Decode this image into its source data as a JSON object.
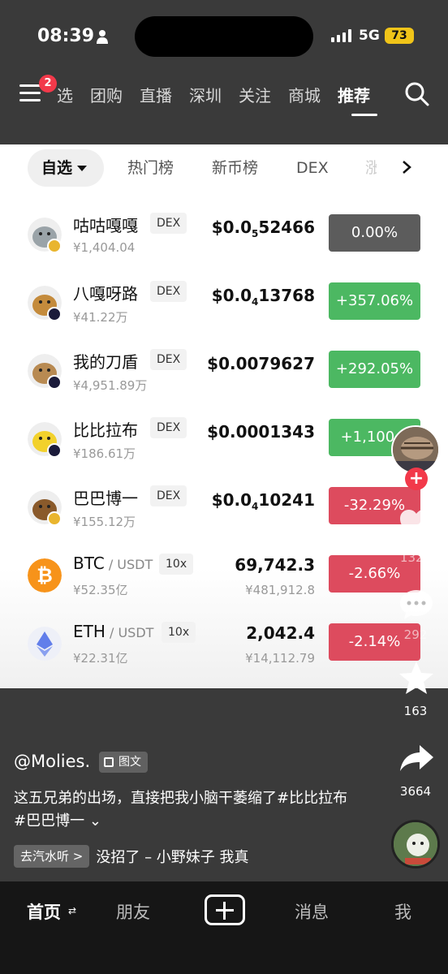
{
  "status_bar": {
    "time": "08:39",
    "network": "5G",
    "battery": "73"
  },
  "top_nav": {
    "badge": "2",
    "tabs": [
      "选",
      "团购",
      "直播",
      "深圳",
      "关注",
      "商城",
      "推荐"
    ],
    "active_tab": "推荐"
  },
  "filters": {
    "selected": "自选",
    "items": [
      "热门榜",
      "新币榜",
      "DEX",
      "涨"
    ]
  },
  "coins": [
    {
      "name": "咕咕嘎嘎",
      "tag": "DEX",
      "mcap": "¥1,404.04",
      "price_pre": "$0.0",
      "price_sub": "5",
      "price_post": "52466",
      "change": "0.00%",
      "change_color": "#5c5c5c",
      "avatar_color": "#9aa3a8",
      "chain_color": "#e9b52e"
    },
    {
      "name": "八嘎呀路",
      "tag": "DEX",
      "mcap": "¥41.22万",
      "price_pre": "$0.0",
      "price_sub": "4",
      "price_post": "13768",
      "change": "+357.06%",
      "change_color": "#4cb862",
      "avatar_color": "#c48b3c",
      "chain_color": "#1b1b3a"
    },
    {
      "name": "我的刀盾",
      "tag": "DEX",
      "mcap": "¥4,951.89万",
      "price_pre": "$0.0079627",
      "price_sub": "",
      "price_post": "",
      "change": "+292.05%",
      "change_color": "#4cb862",
      "avatar_color": "#b88a52",
      "chain_color": "#1b1b3a"
    },
    {
      "name": "比比拉布",
      "tag": "DEX",
      "mcap": "¥186.61万",
      "price_pre": "$0.0001343",
      "price_sub": "",
      "price_post": "",
      "change": "+1,100.6",
      "change_color": "#4cb862",
      "avatar_color": "#f2d12c",
      "chain_color": "#1b1b3a"
    },
    {
      "name": "巴巴博一",
      "tag": "DEX",
      "mcap": "¥155.12万",
      "price_pre": "$0.0",
      "price_sub": "4",
      "price_post": "10241",
      "change": "-32.29%",
      "change_color": "#dd4b5e",
      "avatar_color": "#8a5a2b",
      "chain_color": "#e9b52e"
    },
    {
      "name": "BTC",
      "pair": " / USDT",
      "tag": "10x",
      "mcap": "¥52.35亿",
      "price_pre": "69,742.3",
      "price_sub": "",
      "price_post": "",
      "sub_price": "¥481,912.8",
      "change": "-2.66%",
      "change_color": "#dd4b5e",
      "avatar_color": "#f7931a",
      "avatar_icon": "bitcoin"
    },
    {
      "name": "ETH",
      "pair": " / USDT",
      "tag": "10x",
      "mcap": "¥22.31亿",
      "price_pre": "2,042.4",
      "price_sub": "",
      "price_post": "",
      "sub_price": "¥14,112.79",
      "change": "-2.14%",
      "change_color": "#dd4b5e",
      "avatar_color": "#eef0f8",
      "avatar_icon": "ethereum"
    }
  ],
  "side": {
    "likes": "1323",
    "comments": "292",
    "favorites": "163",
    "shares": "3664"
  },
  "post": {
    "author": "@Molies.",
    "type": "图文",
    "caption": "这五兄弟的出场，直接把我小脑干萎缩了#比比拉布 #巴巴博一",
    "music_chip": "去汽水听 >",
    "music": "没招了 – 小野妹子    我真"
  },
  "bottom_nav": {
    "home": "首页",
    "friends": "朋友",
    "messages": "消息",
    "me": "我"
  }
}
